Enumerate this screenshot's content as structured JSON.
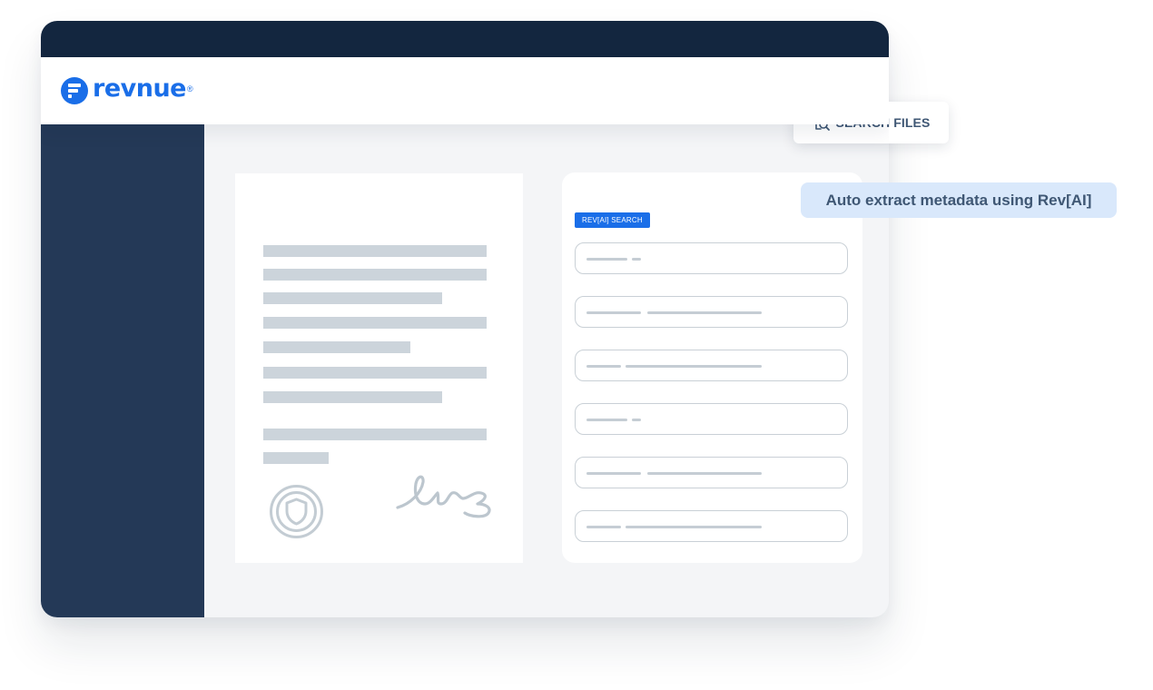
{
  "app": {
    "brand": "revnue",
    "brand_mark": "®",
    "logo_icon": "revnue-logo-icon",
    "brand_color": "#1a6ee8",
    "titlebar_color": "#13263f",
    "sidebar_color": "#243957"
  },
  "toolbar": {
    "search_files_label": "SEARCH FILES",
    "search_files_icon": "file-search-icon"
  },
  "callout": {
    "text": "Auto extract metadata using Rev[AI]"
  },
  "search_panel": {
    "tag": "REV[AI] SEARCH",
    "field_count": 6
  },
  "document": {
    "seal_icon": "shield-seal-icon",
    "signature_icon": "signature-icon"
  }
}
